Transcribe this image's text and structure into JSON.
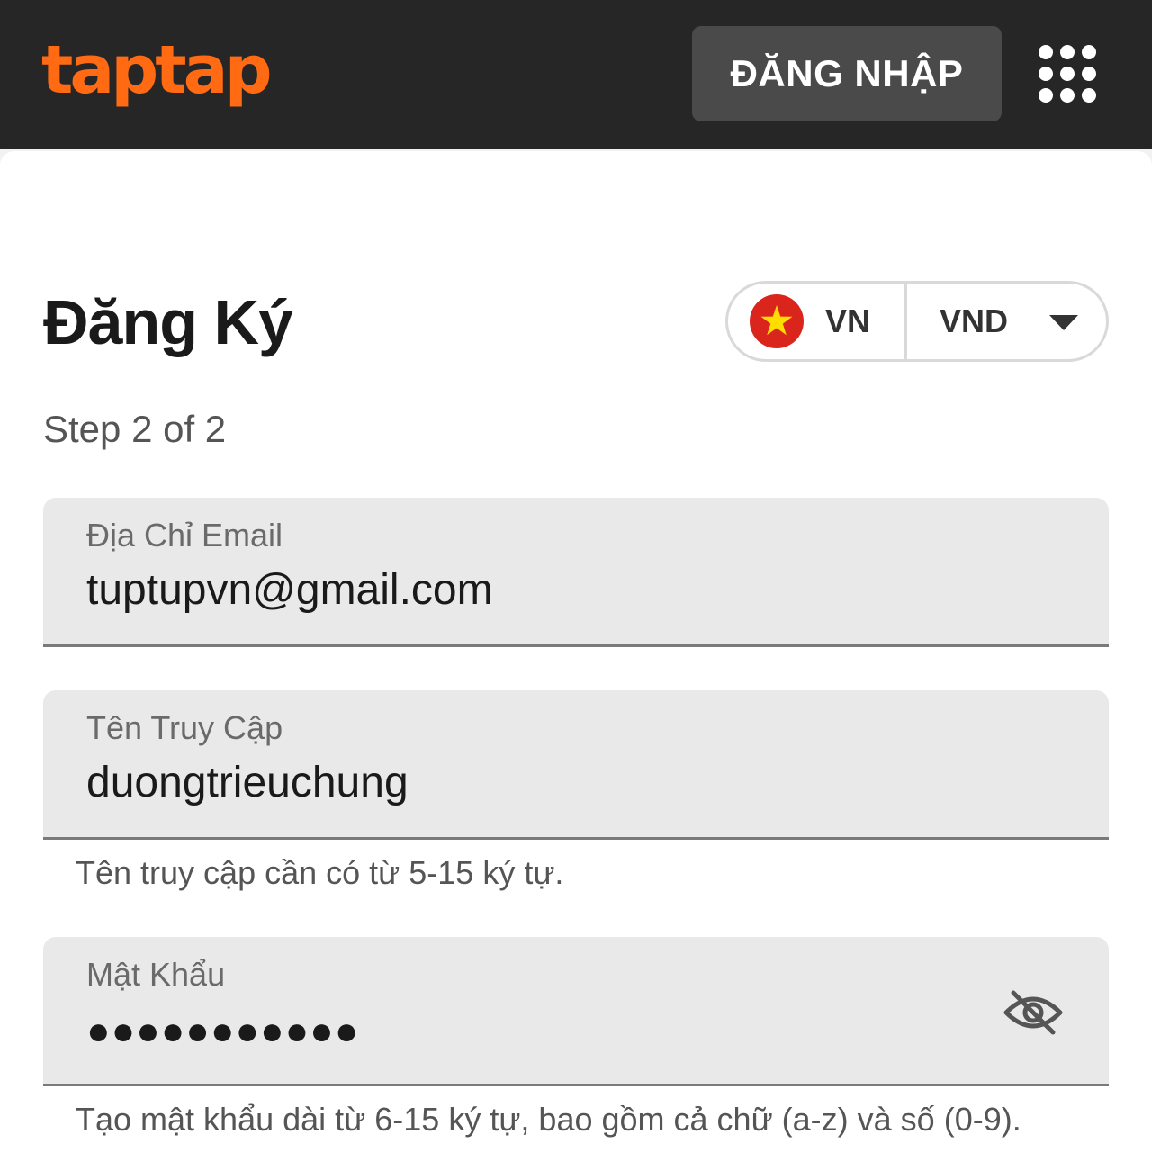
{
  "header": {
    "logo_text": "taptap",
    "login_label": "ĐĂNG NHẬP",
    "menu_icon": "grid-icon",
    "colors": {
      "bar": "#262626",
      "logo": "#ff6a13",
      "button": "#4a4a4a"
    }
  },
  "form": {
    "title": "Đăng Ký",
    "step": "Step 2 of 2",
    "locale": {
      "country_code": "VN",
      "currency": "VND",
      "flag_icon": "vietnam-flag-icon",
      "dropdown_icon": "caret-down-icon"
    },
    "email": {
      "label": "Địa Chỉ Email",
      "value": "tuptupvn@gmail.com"
    },
    "username": {
      "label": "Tên Truy Cập",
      "value": "duongtrieuchung",
      "hint": "Tên truy cập cần có từ 5-15 ký tự."
    },
    "password": {
      "label": "Mật Khẩu",
      "masked_value": "●●●●●●●●●●●",
      "toggle_icon": "eye-slash-icon",
      "hint": "Tạo mật khẩu dài từ 6-15 ký tự, bao gồm cả chữ (a-z) và số (0-9)."
    }
  }
}
